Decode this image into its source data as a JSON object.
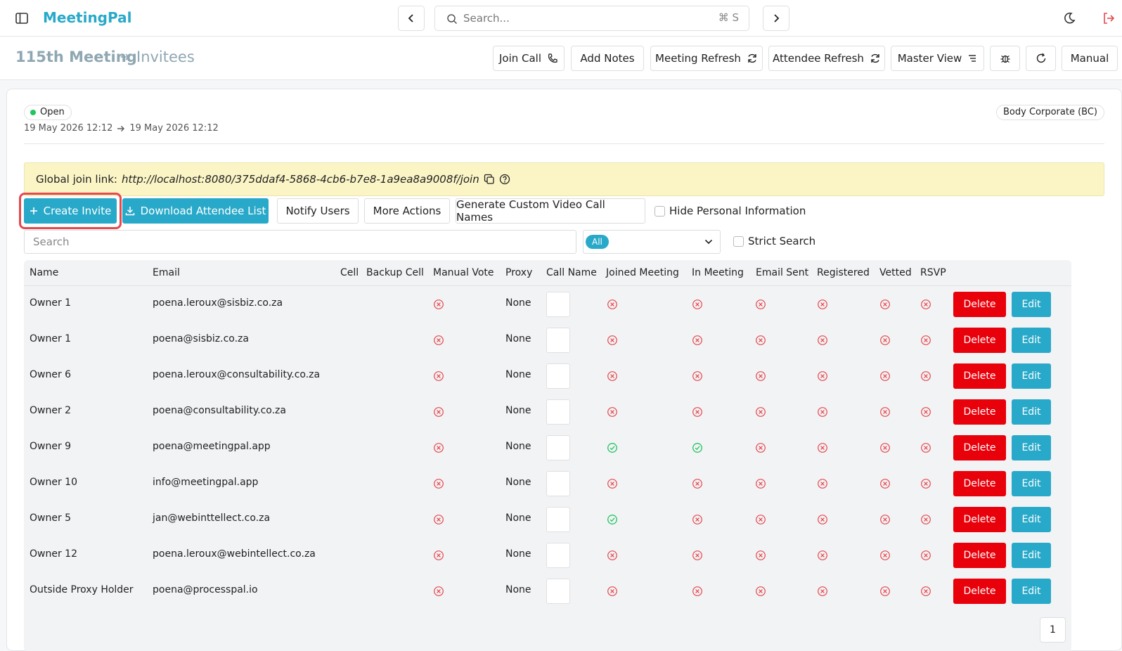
{
  "app": {
    "brand": "MeetingPal"
  },
  "top_search": {
    "placeholder": "Search...",
    "shortcut": "⌘ S"
  },
  "breadcrumb": {
    "meeting": "115th Meeting",
    "page": "Invitees"
  },
  "toolbar": {
    "join_call": "Join Call",
    "add_notes": "Add Notes",
    "meeting_refresh": "Meeting Refresh",
    "attendee_refresh": "Attendee Refresh",
    "master_view": "Master View",
    "manual": "Manual"
  },
  "meeting": {
    "status": "Open",
    "start": "19 May 2026 12:12",
    "end": "19 May 2026 12:12",
    "type": "Body Corporate (BC)"
  },
  "join_link": {
    "label": "Global join link:",
    "url": "http://localhost:8080/375ddaf4-5868-4cb6-b7e8-1a9ea8a9008f/join"
  },
  "actions": {
    "create_invite": "Create Invite",
    "download_list": "Download Attendee List",
    "notify_users": "Notify Users",
    "more_actions": "More Actions",
    "custom_names": "Generate Custom Video Call Names",
    "hide_personal": "Hide Personal Information"
  },
  "filters": {
    "search_placeholder": "Search",
    "selected": "All",
    "strict_search": "Strict Search"
  },
  "table": {
    "headers": [
      "Name",
      "Email",
      "Cell",
      "Backup Cell",
      "Manual Vote",
      "Proxy",
      "Call Name",
      "Joined Meeting",
      "In Meeting",
      "Email Sent",
      "Registered",
      "Vetted",
      "RSVP"
    ],
    "delete_label": "Delete",
    "edit_label": "Edit",
    "rows": [
      {
        "name": "Owner 1",
        "email": "poena.leroux@sisbiz.co.za",
        "proxy": "None",
        "manual_vote": false,
        "joined": false,
        "in_meeting": false,
        "email_sent": false,
        "registered": false,
        "vetted": false,
        "rsvp": false
      },
      {
        "name": "Owner 1",
        "email": "poena@sisbiz.co.za",
        "proxy": "None",
        "manual_vote": false,
        "joined": false,
        "in_meeting": false,
        "email_sent": false,
        "registered": false,
        "vetted": false,
        "rsvp": false
      },
      {
        "name": "Owner 6",
        "email": "poena.leroux@consultability.co.za",
        "proxy": "None",
        "manual_vote": false,
        "joined": false,
        "in_meeting": false,
        "email_sent": false,
        "registered": false,
        "vetted": false,
        "rsvp": false
      },
      {
        "name": "Owner 2",
        "email": "poena@consultability.co.za",
        "proxy": "None",
        "manual_vote": false,
        "joined": false,
        "in_meeting": false,
        "email_sent": false,
        "registered": false,
        "vetted": false,
        "rsvp": false
      },
      {
        "name": "Owner 9",
        "email": "poena@meetingpal.app",
        "proxy": "None",
        "manual_vote": false,
        "joined": true,
        "in_meeting": true,
        "email_sent": false,
        "registered": false,
        "vetted": false,
        "rsvp": false
      },
      {
        "name": "Owner 10",
        "email": "info@meetingpal.app",
        "proxy": "None",
        "manual_vote": false,
        "joined": false,
        "in_meeting": false,
        "email_sent": false,
        "registered": false,
        "vetted": false,
        "rsvp": false
      },
      {
        "name": "Owner 5",
        "email": "jan@webinttellect.co.za",
        "proxy": "None",
        "manual_vote": false,
        "joined": true,
        "in_meeting": false,
        "email_sent": false,
        "registered": false,
        "vetted": false,
        "rsvp": false
      },
      {
        "name": "Owner 12",
        "email": "poena.leroux@webintellect.co.za",
        "proxy": "None",
        "manual_vote": false,
        "joined": false,
        "in_meeting": false,
        "email_sent": false,
        "registered": false,
        "vetted": false,
        "rsvp": false
      },
      {
        "name": "Outside Proxy Holder",
        "email": "poena@processpal.io",
        "proxy": "None",
        "manual_vote": false,
        "joined": false,
        "in_meeting": false,
        "email_sent": false,
        "registered": false,
        "vetted": false,
        "rsvp": false
      }
    ]
  },
  "pagination": {
    "current_page": "1"
  },
  "colors": {
    "accent": "#29a9c9",
    "danger": "#e8000b",
    "success": "#22c55e",
    "status_x": "#e5484d",
    "banner": "#fbf5c6"
  }
}
